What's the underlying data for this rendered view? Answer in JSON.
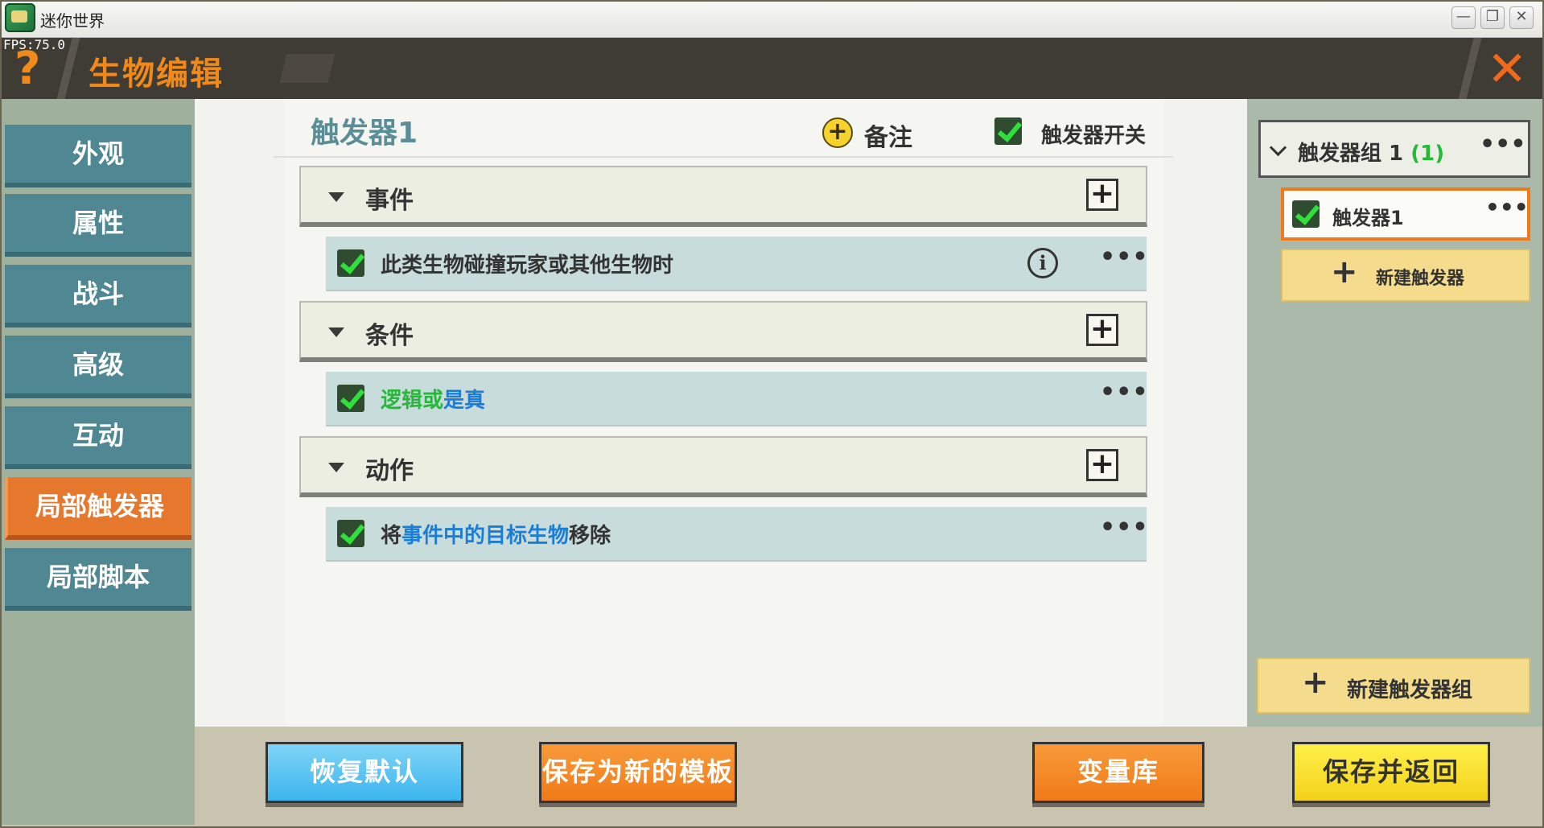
{
  "os": {
    "app_title": "迷你世界",
    "fps": "FPS:75.0",
    "min_glyph": "—",
    "restore_glyph": "❐",
    "close_glyph": "✕"
  },
  "header": {
    "help_glyph": "?",
    "title": "生物编辑",
    "close_glyph": "✕"
  },
  "sidebar": {
    "items": [
      {
        "label": "外观"
      },
      {
        "label": "属性"
      },
      {
        "label": "战斗"
      },
      {
        "label": "高级"
      },
      {
        "label": "互动"
      },
      {
        "label": "局部触发器",
        "active": true
      },
      {
        "label": "局部脚本"
      }
    ]
  },
  "editor": {
    "trigger_name": "触发器1",
    "note_label": "备注",
    "switch_label": "触发器开关",
    "sections": {
      "event": {
        "label": "事件",
        "rows": [
          {
            "text": "此类生物碰撞玩家或其他生物时"
          }
        ]
      },
      "condition": {
        "label": "条件",
        "rows": [
          {
            "part1": "逻辑或",
            "part2": "是真"
          }
        ]
      },
      "action": {
        "label": "动作",
        "rows": [
          {
            "part1": "将",
            "part2": "事件中的目标生物",
            "part3": "移除"
          }
        ]
      }
    },
    "more_glyph": "•••",
    "add_glyph": "+",
    "info_glyph": "i"
  },
  "right_panel": {
    "group_label": "触发器组 1",
    "group_count": "(1)",
    "trigger_item": "触发器1",
    "new_trigger": "新建触发器",
    "new_group": "新建触发器组"
  },
  "bottom": {
    "restore_default": "恢复默认",
    "save_template": "保存为新的模板",
    "variables": "变量库",
    "save_return": "保存并返回"
  },
  "colors": {
    "accent_orange": "#f0891a",
    "sidebar_teal": "#4f8893",
    "check_green": "#2fe03a",
    "link_blue": "#1b7ed6"
  }
}
